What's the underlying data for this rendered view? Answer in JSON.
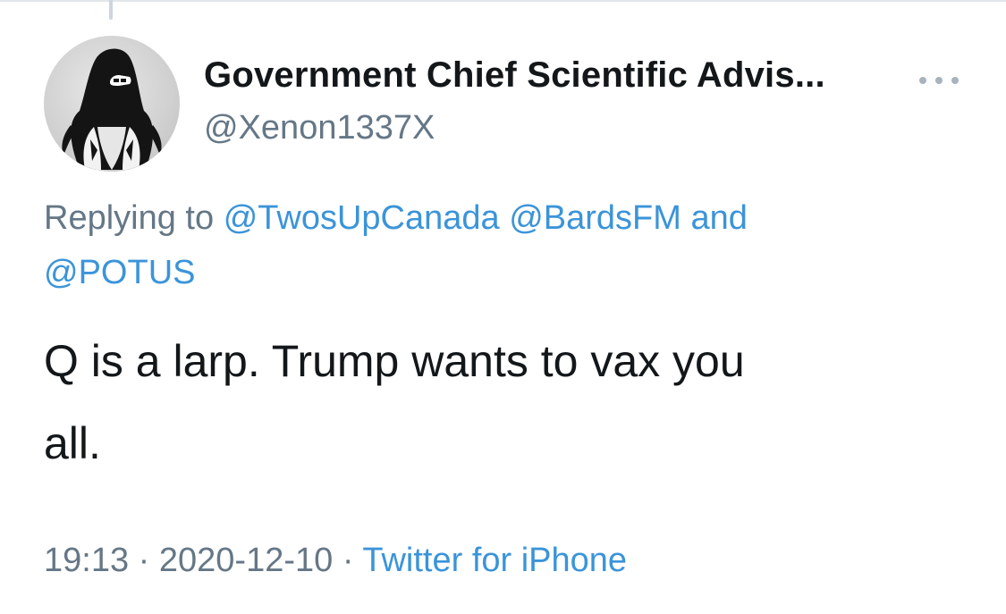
{
  "tweet": {
    "author": {
      "display_name": "Government Chief Scientific Advis...",
      "handle": "@Xenon1337X",
      "avatar_icon": "hooded-figure-avatar"
    },
    "more_icon": "more-horizontal-icon",
    "reply_context": {
      "prefix": "Replying to",
      "mentions": [
        "@TwosUpCanada",
        "@BardsFM"
      ],
      "conjunction": "and",
      "last_mention": "@POTUS"
    },
    "text": "Q is a larp. Trump wants to vax you\nall.",
    "time": "19:13",
    "separator": "·",
    "date": "2020-12-10",
    "source": "Twitter for iPhone"
  },
  "colors": {
    "text": "#14171a",
    "secondary": "#657786",
    "link": "#3b94d9",
    "divider": "#e3e7ea"
  }
}
